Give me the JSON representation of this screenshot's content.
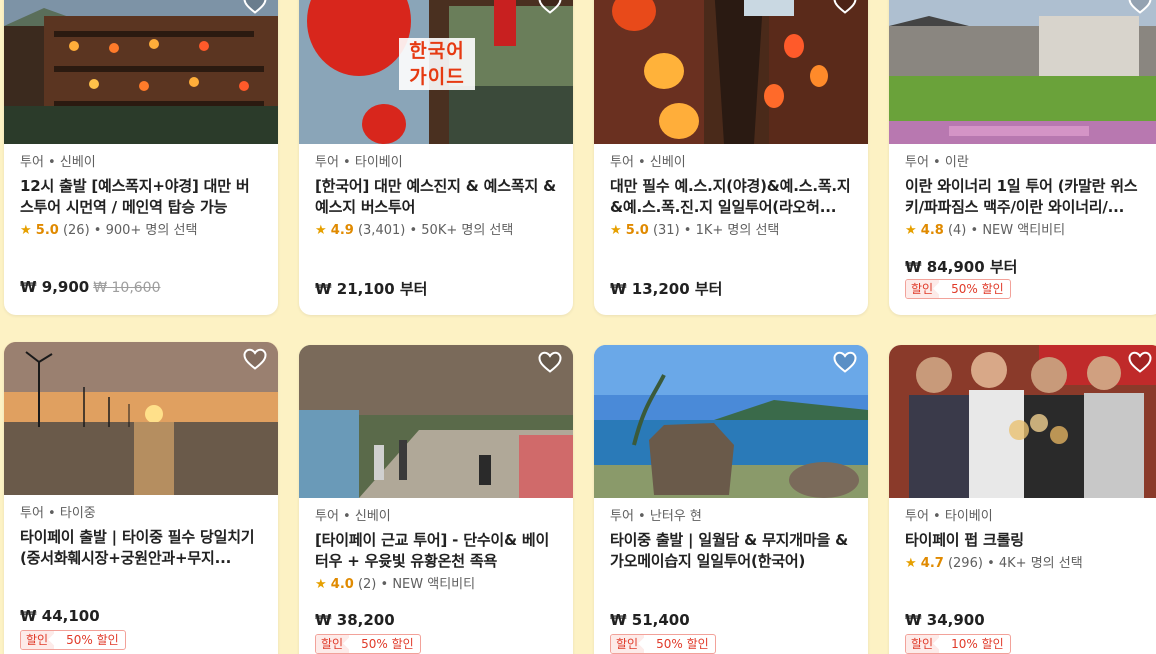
{
  "colors": {
    "background": "#fdf2c4",
    "rating": "#e08a00",
    "discount": "#e03b2a"
  },
  "cards": [
    {
      "category": "투어 • 신베이",
      "title": "12시 출발 [예스폭지+야경] 대만 버스투어 시먼역 / 메인역 탑승 가능",
      "rating": "5.0",
      "reviews": "(26)",
      "popularity": " • 900+ 명의 선택",
      "price": "₩ 9,900",
      "original_price": "₩ 10,600",
      "badge_label": "",
      "badge_value": "",
      "overlay_text": ""
    },
    {
      "category": "투어 • 타이베이",
      "title": "[한국어] 대만 예스진지 & 예스폭지 & 예스지 버스투어",
      "rating": "4.9",
      "reviews": "(3,401)",
      "popularity": " • 50K+ 명의 선택",
      "price": "₩ 21,100 부터",
      "original_price": "",
      "badge_label": "",
      "badge_value": "",
      "overlay_text": "한국어 가이드"
    },
    {
      "category": "투어 • 신베이",
      "title": "대만 필수 예.스.지(야경)&예.스.폭.지&예.스.폭.진.지 일일투어(라오허...",
      "rating": "5.0",
      "reviews": "(31)",
      "popularity": " • 1K+ 명의 선택",
      "price": "₩ 13,200 부터",
      "original_price": "",
      "badge_label": "",
      "badge_value": "",
      "overlay_text": ""
    },
    {
      "category": "투어 • 이란",
      "title": "이란 와이너리 1일 투어 (카말란 위스키/파파짐스 맥주/이란 와이너리/...",
      "rating": "4.8",
      "reviews": "(4)",
      "popularity": " • NEW 액티비티",
      "price": "₩ 84,900 부터",
      "original_price": "",
      "badge_label": "할인",
      "badge_value": "50% 할인",
      "overlay_text": ""
    },
    {
      "category": "투어 • 타이중",
      "title": "타이페이 출발 | 타이중 필수 당일치기 (중서화훼시장+궁원안과+무지...",
      "rating": "",
      "reviews": "",
      "popularity": "",
      "price": "₩ 44,100",
      "original_price": "",
      "badge_label": "할인",
      "badge_value": "50% 할인",
      "overlay_text": ""
    },
    {
      "category": "투어 • 신베이",
      "title": "[타이페이 근교 투어] - 단수이& 베이터우 + 우윳빛 유황온천 족욕",
      "rating": "4.0",
      "reviews": "(2)",
      "popularity": " • NEW 액티비티",
      "price": "₩ 38,200",
      "original_price": "",
      "badge_label": "할인",
      "badge_value": "50% 할인",
      "overlay_text": ""
    },
    {
      "category": "투어 • 난터우 현",
      "title": "타이중 출발 | 일월담 & 무지개마을 & 가오메이습지 일일투어(한국어)",
      "rating": "",
      "reviews": "",
      "popularity": "",
      "price": "₩ 51,400",
      "original_price": "",
      "badge_label": "할인",
      "badge_value": "50% 할인",
      "overlay_text": ""
    },
    {
      "category": "투어 • 타이베이",
      "title": "타이페이 펍 크롤링",
      "rating": "4.7",
      "reviews": "(296)",
      "popularity": " • 4K+ 명의 선택",
      "price": "₩ 34,900",
      "original_price": "",
      "badge_label": "할인",
      "badge_value": "10% 할인",
      "overlay_text": ""
    }
  ]
}
